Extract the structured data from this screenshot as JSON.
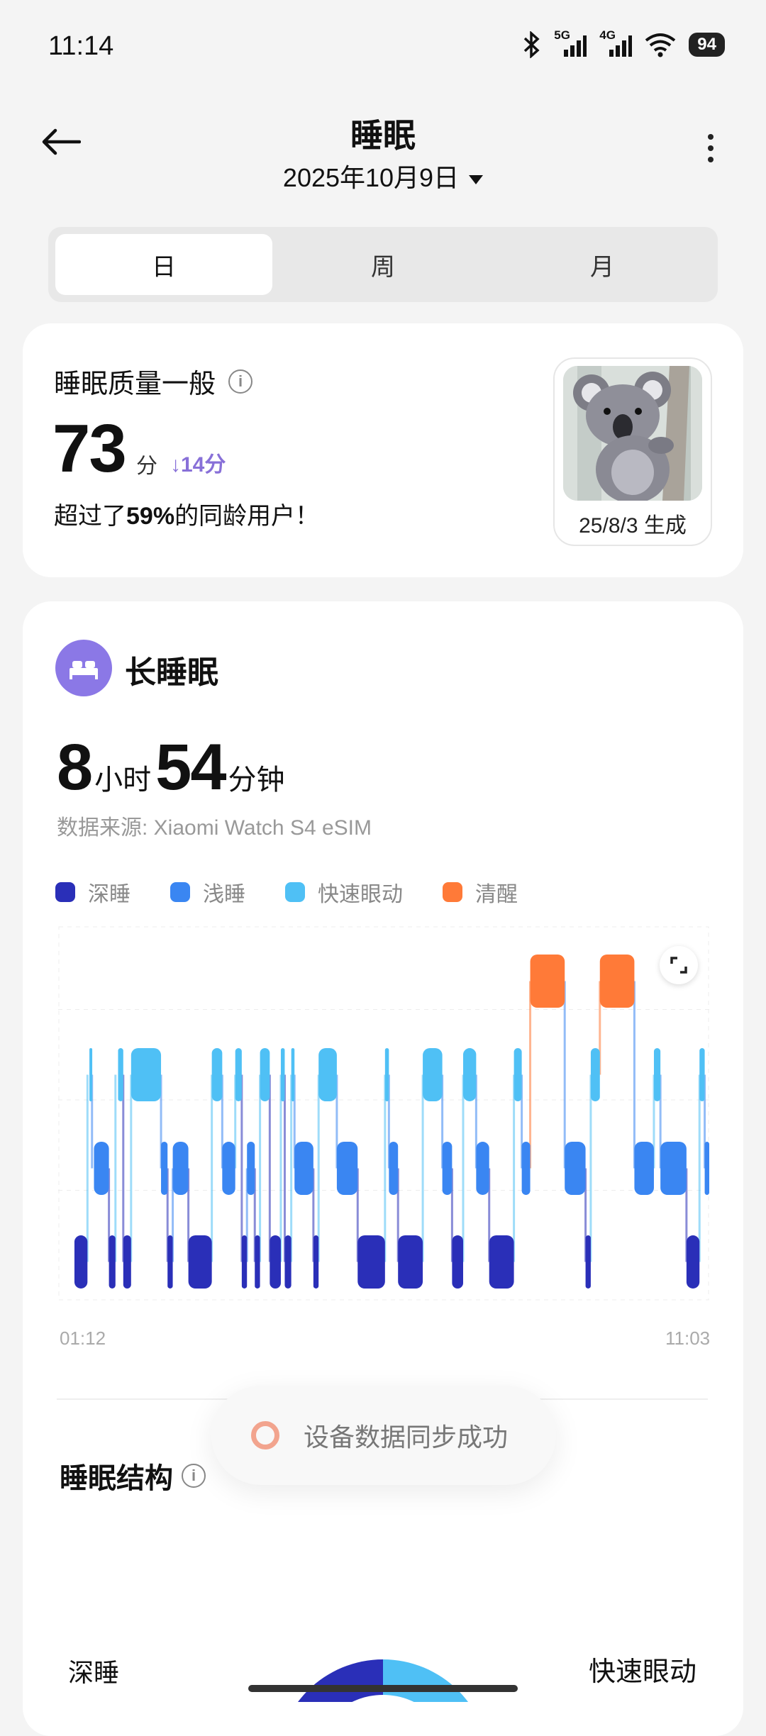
{
  "status_bar": {
    "time": "11:14",
    "network_5g": "5G",
    "network_4g": "4G",
    "battery": "94"
  },
  "header": {
    "title": "睡眠",
    "date": "2025年10月9日"
  },
  "tabs": [
    {
      "label": "日",
      "active": true
    },
    {
      "label": "周",
      "active": false
    },
    {
      "label": "月",
      "active": false
    }
  ],
  "quality": {
    "label": "睡眠质量一般",
    "score": "73",
    "unit": "分",
    "change": "14分",
    "compare_prefix": "超过了",
    "compare_percent": "59%",
    "compare_suffix": "的同龄用户！",
    "koala_caption": "25/8/3 生成"
  },
  "sleep": {
    "type": "长睡眠",
    "hours": "8",
    "hours_unit": "小时",
    "minutes": "54",
    "minutes_unit": "分钟",
    "source": "数据来源: Xiaomi Watch S4 eSIM",
    "legend": [
      {
        "label": "深睡",
        "color": "#2a2fb8"
      },
      {
        "label": "浅睡",
        "color": "#3a86f2"
      },
      {
        "label": "快速眼动",
        "color": "#4fc0f5"
      },
      {
        "label": "清醒",
        "color": "#ff7a38"
      }
    ],
    "axis_start": "01:12",
    "axis_end": "11:03"
  },
  "chart_data": {
    "type": "timeline",
    "stages": [
      "awake",
      "rem",
      "light",
      "deep"
    ],
    "segments": [
      {
        "stage": "deep",
        "start": 0.025,
        "end": 0.045
      },
      {
        "stage": "rem",
        "start": 0.048,
        "end": 0.052
      },
      {
        "stage": "light",
        "start": 0.055,
        "end": 0.078
      },
      {
        "stage": "deep",
        "start": 0.078,
        "end": 0.088
      },
      {
        "stage": "rem",
        "start": 0.092,
        "end": 0.1
      },
      {
        "stage": "deep",
        "start": 0.1,
        "end": 0.112
      },
      {
        "stage": "rem",
        "start": 0.112,
        "end": 0.158
      },
      {
        "stage": "light",
        "start": 0.158,
        "end": 0.168
      },
      {
        "stage": "deep",
        "start": 0.168,
        "end": 0.176
      },
      {
        "stage": "light",
        "start": 0.176,
        "end": 0.2
      },
      {
        "stage": "deep",
        "start": 0.2,
        "end": 0.236
      },
      {
        "stage": "rem",
        "start": 0.236,
        "end": 0.252
      },
      {
        "stage": "light",
        "start": 0.252,
        "end": 0.272
      },
      {
        "stage": "rem",
        "start": 0.272,
        "end": 0.282
      },
      {
        "stage": "deep",
        "start": 0.282,
        "end": 0.29
      },
      {
        "stage": "light",
        "start": 0.29,
        "end": 0.302
      },
      {
        "stage": "deep",
        "start": 0.302,
        "end": 0.31
      },
      {
        "stage": "rem",
        "start": 0.31,
        "end": 0.325
      },
      {
        "stage": "deep",
        "start": 0.325,
        "end": 0.342
      },
      {
        "stage": "rem",
        "start": 0.342,
        "end": 0.348
      },
      {
        "stage": "deep",
        "start": 0.348,
        "end": 0.358
      },
      {
        "stage": "rem",
        "start": 0.358,
        "end": 0.363
      },
      {
        "stage": "light",
        "start": 0.363,
        "end": 0.392
      },
      {
        "stage": "deep",
        "start": 0.392,
        "end": 0.4
      },
      {
        "stage": "rem",
        "start": 0.4,
        "end": 0.428
      },
      {
        "stage": "light",
        "start": 0.428,
        "end": 0.46
      },
      {
        "stage": "deep",
        "start": 0.46,
        "end": 0.502
      },
      {
        "stage": "rem",
        "start": 0.502,
        "end": 0.508
      },
      {
        "stage": "light",
        "start": 0.508,
        "end": 0.522
      },
      {
        "stage": "deep",
        "start": 0.522,
        "end": 0.56
      },
      {
        "stage": "rem",
        "start": 0.56,
        "end": 0.59
      },
      {
        "stage": "light",
        "start": 0.59,
        "end": 0.605
      },
      {
        "stage": "deep",
        "start": 0.605,
        "end": 0.622
      },
      {
        "stage": "rem",
        "start": 0.622,
        "end": 0.642
      },
      {
        "stage": "light",
        "start": 0.642,
        "end": 0.662
      },
      {
        "stage": "deep",
        "start": 0.662,
        "end": 0.7
      },
      {
        "stage": "rem",
        "start": 0.7,
        "end": 0.712
      },
      {
        "stage": "light",
        "start": 0.712,
        "end": 0.725
      },
      {
        "stage": "awake",
        "start": 0.725,
        "end": 0.778
      },
      {
        "stage": "light",
        "start": 0.778,
        "end": 0.81
      },
      {
        "stage": "deep",
        "start": 0.81,
        "end": 0.818
      },
      {
        "stage": "rem",
        "start": 0.818,
        "end": 0.832
      },
      {
        "stage": "awake",
        "start": 0.832,
        "end": 0.885
      },
      {
        "stage": "light",
        "start": 0.885,
        "end": 0.915
      },
      {
        "stage": "rem",
        "start": 0.915,
        "end": 0.925
      },
      {
        "stage": "light",
        "start": 0.925,
        "end": 0.965
      },
      {
        "stage": "deep",
        "start": 0.965,
        "end": 0.985
      },
      {
        "stage": "rem",
        "start": 0.985,
        "end": 0.993
      },
      {
        "stage": "light",
        "start": 0.993,
        "end": 1.0
      }
    ]
  },
  "structure": {
    "title": "睡眠结构",
    "label_left": "深睡",
    "label_right": "快速眼动"
  },
  "toast": {
    "message": "设备数据同步成功"
  }
}
